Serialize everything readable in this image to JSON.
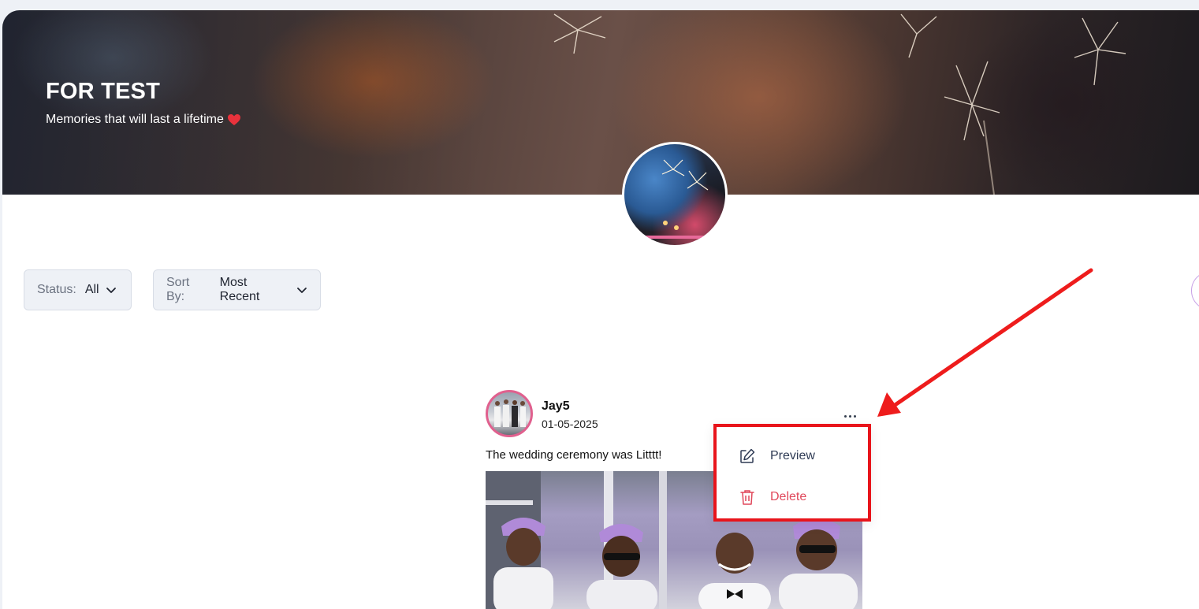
{
  "album": {
    "title": "FOR TEST",
    "subtitle": "Memories that will last a lifetime"
  },
  "filters": {
    "status": {
      "label": "Status:",
      "value": "All"
    },
    "sort": {
      "label": "Sort By:",
      "value": "Most Recent"
    }
  },
  "post": {
    "username": "Jay5",
    "date": "01-05-2025",
    "caption": "The wedding ceremony was Litttt!"
  },
  "menu": {
    "preview_label": "Preview",
    "delete_label": "Delete"
  },
  "icons": {
    "heart": "heart-icon",
    "chevron": "chevron-down-icon",
    "more": "more-horizontal-icon",
    "edit": "edit-icon",
    "trash": "trash-icon"
  },
  "colors": {
    "highlight_red": "#e8141b",
    "delete_red": "#e0475a",
    "preview_text": "#2e3a54",
    "avatar_ring": "#e0608e"
  }
}
